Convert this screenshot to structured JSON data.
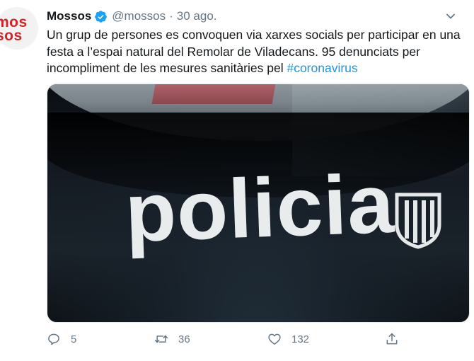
{
  "avatar": {
    "line1": "mos",
    "line2": "sos"
  },
  "tweet": {
    "name": "Mossos",
    "handle": "@mossos",
    "separator": "·",
    "date": "30 ago.",
    "text_main": "Un grup de persones es convoquen via xarxes socials per participar en una festa a l’espai natural del Remolar de Viladecans. 95 denunciats per incompliment de les mesures sanitàries pel ",
    "hashtag": "#coronavirus"
  },
  "media": {
    "car_text": "policia"
  },
  "actions": {
    "replies": "5",
    "retweets": "36",
    "likes": "132"
  },
  "colors": {
    "link": "#1b95e0",
    "verified": "#1da1f2",
    "muted": "#657786",
    "avatar_text": "#d2232a"
  },
  "icons": [
    "verified-icon",
    "caret-down-icon",
    "reply-icon",
    "retweet-icon",
    "like-icon",
    "share-icon"
  ]
}
